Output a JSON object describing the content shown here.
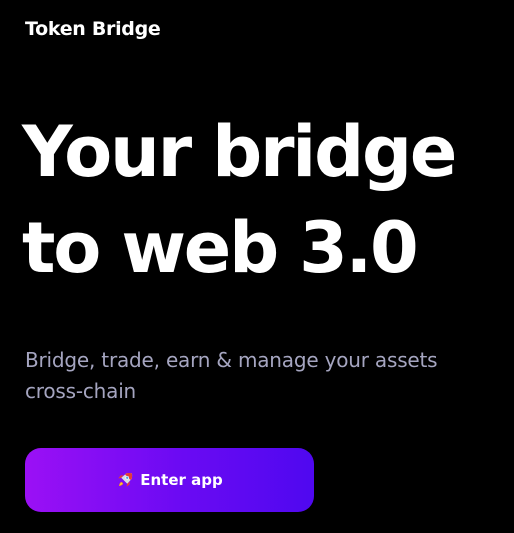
{
  "header": {
    "brand": "Token Bridge"
  },
  "hero": {
    "headline_line1": "Your bridge",
    "headline_line2": "to web 3.0",
    "subtitle": "Bridge, trade, earn & manage your assets cross-chain"
  },
  "cta": {
    "icon": "rocket-icon",
    "label": "Enter app"
  },
  "colors": {
    "background": "#000000",
    "text": "#ffffff",
    "subtitle": "#a5a5c0",
    "button_gradient_start": "#9b10f5",
    "button_gradient_end": "#4f08f0"
  }
}
